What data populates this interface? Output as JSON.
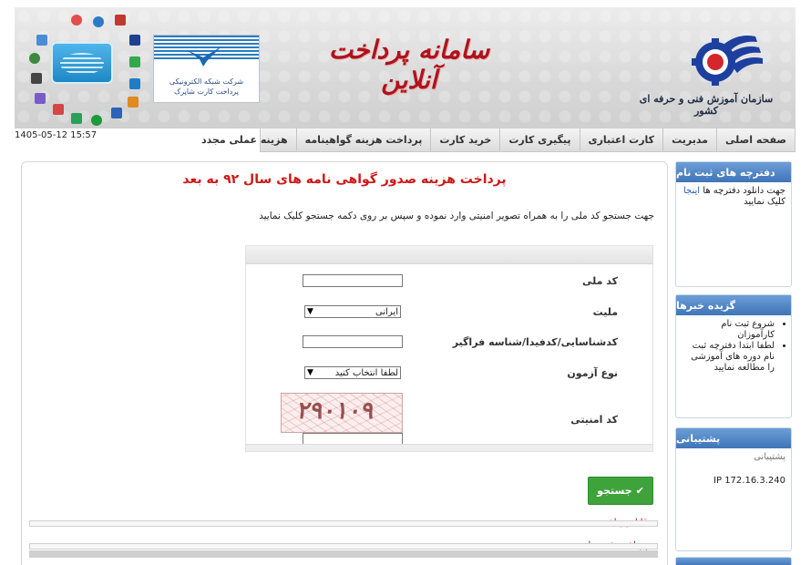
{
  "header": {
    "app_title": "سامانه پرداخت آنلاین",
    "org_name": "سازمان آموزش فنی و حرفه ای کشور",
    "bank_caption": "شرکت شبکه الکترونیکی پرداخت کارت شاپرک",
    "captcha_code": "۲۹۰۱۰۹"
  },
  "datetime": "1405-05-12 15:57",
  "nav": {
    "items": [
      {
        "label": "صفحه اصلی"
      },
      {
        "label": "مدیریت"
      },
      {
        "label": "کارت اعتباری"
      },
      {
        "label": "پیگیری کارت"
      },
      {
        "label": "خرید کارت"
      },
      {
        "label": "پرداخت هزینه گواهینامه"
      },
      {
        "label": "هزینه عملی مجدد"
      }
    ]
  },
  "main": {
    "title": "پرداخت هزینه صدور گواهی نامه های سال ۹۲ به بعد",
    "instruction": "جهت جستجو کد ملی را به همراه تصویر امنیتی وارد نموده و سپس بر روی دکمه جستجو کلیک نمایید",
    "form": {
      "national_code_label": "کد ملی",
      "national_code_value": "",
      "nationality_label": "ملیت",
      "nationality_value": "ایرانی",
      "tracking_label": "کدشناسایی/کدفیدا/شناسه فراگیر",
      "tracking_value": "",
      "exam_type_label": "نوع آزمون",
      "exam_type_value": "لطفا انتخاب کنید",
      "captcha_label": "کد امنیتی",
      "captcha_value": ""
    },
    "search_button": "جستجو",
    "payable_label": "قابل پرداخت:",
    "paid_label": "پرداخت شده ها:"
  },
  "sidebar": {
    "registration": {
      "title": "دفترچه های ثبت نام",
      "text_before": "جهت دانلود دفترچه ها",
      "link": "اینجا",
      "text_after": "کلیک نمایید"
    },
    "news": {
      "title": "گزیده خبرها",
      "items": [
        "شروع ثبت نام کارآموزان",
        "لطفا ابتدا دفترچه ثبت نام دوره های آموزشی را مطالعه نمایید"
      ]
    },
    "support": {
      "title": "پشتیبانی",
      "label": "پشتیبانی",
      "ip": "IP 172.16.3.240"
    }
  },
  "colors": {
    "title_red": "#d01818",
    "button_green": "#3fa33b",
    "side_head_blue": "#3f74b8"
  }
}
